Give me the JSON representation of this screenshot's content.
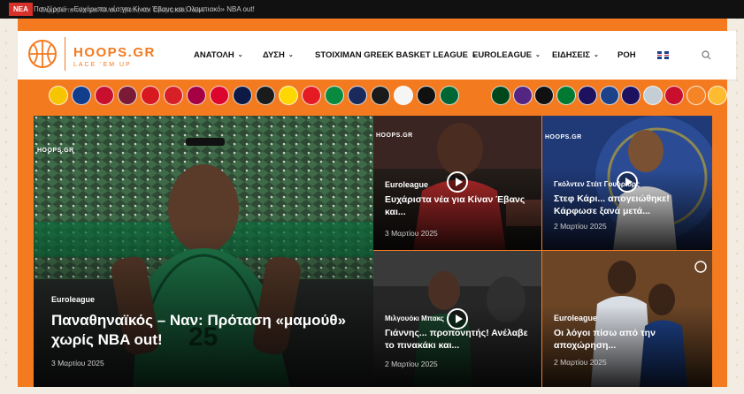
{
  "ticker": {
    "badge": "ΝΕΑ",
    "text": "Πανζέρσεϊ· «Ευχάριστα νέα για Κίναν Έβανς και Ολυμπιακό» NBA out!",
    "ghost": "Ευχάριστα νέα για Κίναν Έβανς και Ολυμπιακό NBA"
  },
  "logo": {
    "name": "HOOPS.GR",
    "tagline": "LACE 'EM UP"
  },
  "nav": {
    "items": [
      {
        "label": "ΑΝΑΤΟΛΗ",
        "dropdown": true
      },
      {
        "label": "ΔΥΣΗ",
        "dropdown": true
      },
      {
        "label": "STOIXIMAN GREEK BASKET LEAGUE",
        "dropdown": true
      },
      {
        "label": "EUROLEAGUE",
        "dropdown": true
      },
      {
        "label": "ΕΙΔΗΣΕΙΣ",
        "dropdown": true
      },
      {
        "label": "ΡΟΗ",
        "dropdown": false
      }
    ],
    "language_flag": "uk-flag-icon",
    "search_icon": "search-icon"
  },
  "teams_euroleague": [
    {
      "name": "alba-berlin-logo",
      "color": "#f7c400"
    },
    {
      "name": "anadolu-efes-logo",
      "color": "#123c8c"
    },
    {
      "name": "monaco-logo",
      "color": "#c8102e"
    },
    {
      "name": "baskonia-logo",
      "color": "#7a1a36"
    },
    {
      "name": "crvena-zvezda-logo",
      "color": "#d71920"
    },
    {
      "name": "olympiacos-logo",
      "color": "#d61f26"
    },
    {
      "name": "barcelona-logo",
      "color": "#a50044"
    },
    {
      "name": "bayern-logo",
      "color": "#dc052d"
    },
    {
      "name": "fenerbahce-logo",
      "color": "#0d1a45"
    },
    {
      "name": "asvel-logo",
      "color": "#1b1b1b"
    },
    {
      "name": "maccabi-logo",
      "color": "#ffd700"
    },
    {
      "name": "olympiacos-alt-logo",
      "color": "#e41b23"
    },
    {
      "name": "panathinaikos-logo",
      "color": "#0a8a3f"
    },
    {
      "name": "paris-logo",
      "color": "#1b2a5c"
    },
    {
      "name": "partizan-logo",
      "color": "#1a1a1a"
    },
    {
      "name": "real-madrid-logo",
      "color": "#f5f5f5"
    },
    {
      "name": "virtus-logo",
      "color": "#111111"
    },
    {
      "name": "zalgiris-logo",
      "color": "#006633"
    }
  ],
  "teams_nba": [
    {
      "name": "bucks-logo",
      "color": "#00471b"
    },
    {
      "name": "lakers-logo",
      "color": "#552583"
    },
    {
      "name": "nets-logo",
      "color": "#111111"
    },
    {
      "name": "celtics-logo",
      "color": "#007a33"
    },
    {
      "name": "hornets-logo",
      "color": "#1d1160"
    },
    {
      "name": "warriors-logo",
      "color": "#1d428a"
    },
    {
      "name": "suns-logo",
      "color": "#1d1160"
    },
    {
      "name": "spurs-logo",
      "color": "#c4ced4"
    },
    {
      "name": "clippers-logo",
      "color": "#c8102e"
    },
    {
      "name": "knicks-logo",
      "color": "#f58426"
    },
    {
      "name": "pacers-logo",
      "color": "#fdbb30"
    }
  ],
  "articles": {
    "main": {
      "category": "Euroleague",
      "title": "Παναθηναϊκός – Ναν: Πρόταση «μαμούθ» χωρίς NBA out!",
      "date": "3 Μαρτίου 2025",
      "watermark": "HOOPS.GR"
    },
    "top_left": {
      "category": "Euroleague",
      "title": "Ευχάριστα νέα για Κίναν Έβανς και...",
      "date": "3 Μαρτίου 2025",
      "watermark": "HOOPS.GR"
    },
    "top_right": {
      "category": "Γκόλντεν Στέιτ Γουόριορς",
      "title": "Στεφ Κάρι... απογειώθηκε! Κάρφωσε ξανά μετά...",
      "date": "2 Μαρτίου 2025",
      "watermark": "HOOPS.GR"
    },
    "bottom_left": {
      "category": "Μιλγουόκι Μπακς",
      "title": "Γιάννης... προπονητής! Ανέλαβε το πινακάκι και...",
      "date": "2 Μαρτίου 2025"
    },
    "bottom_right": {
      "category": "Euroleague",
      "title": "Οι λόγοι πίσω από την αποχώρηση...",
      "date": "2 Μαρτίου 2025"
    }
  },
  "colors": {
    "accent": "#f37a1f",
    "ticker_bg": "#111111",
    "badge": "#d6322b"
  }
}
